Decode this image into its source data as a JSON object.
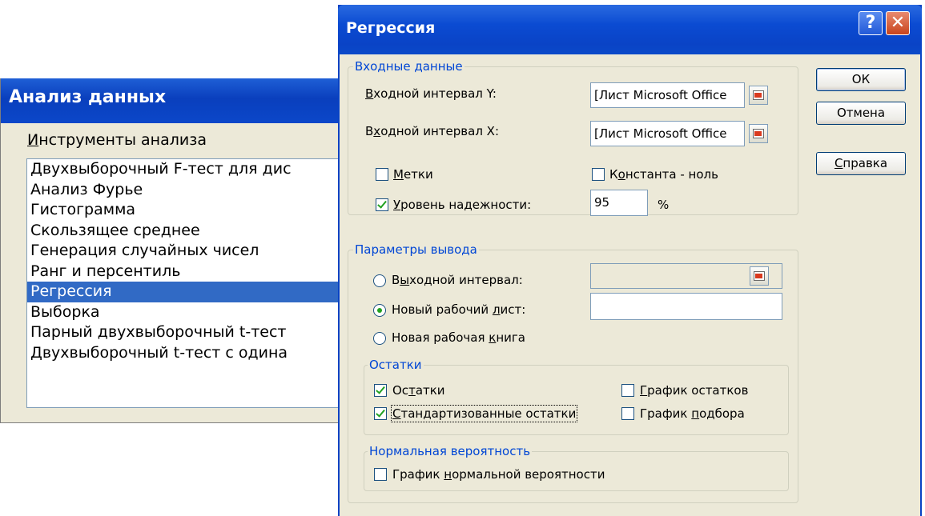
{
  "back_dialog": {
    "title": "Анализ данных",
    "tools_label": "Инструменты анализа",
    "tools": [
      "Двухвыборочный F-тест для дис",
      "Анализ Фурье",
      "Гистограмма",
      "Скользящее среднее",
      "Генерация случайных чисел",
      "Ранг и персентиль",
      "Регрессия",
      "Выборка",
      "Парный двухвыборочный t-тест",
      "Двухвыборочный t-тест с одина"
    ],
    "selected_tool": "Регрессия"
  },
  "dialog": {
    "title": "Регрессия",
    "help_glyph": "?",
    "close_glyph": "✕",
    "input": {
      "legend": "Входные данные",
      "y_label": "Входной интервал Y:",
      "y_value": "[Лист Microsoft Office",
      "x_label": "Входной интервал X:",
      "x_value": "[Лист Microsoft Office",
      "labels_label": "Метки",
      "labels_checked": false,
      "constant_zero_label": "Константа - ноль",
      "constant_zero_checked": false,
      "confidence_label": "Уровень надежности:",
      "confidence_checked": true,
      "confidence_value": "95",
      "percent_sign": "%"
    },
    "output": {
      "legend": "Параметры вывода",
      "output_range_label": "Выходной интервал:",
      "new_sheet_label": "Новый рабочий лист:",
      "new_workbook_label": "Новая рабочая книга",
      "selected_option": "new_sheet",
      "output_range_value": "",
      "new_sheet_value": ""
    },
    "residuals": {
      "legend": "Остатки",
      "residuals_label": "Остатки",
      "residuals_checked": true,
      "standardized_label": "Стандартизованные остатки",
      "standardized_checked": true,
      "residual_plot_label": "График остатков",
      "residual_plot_checked": false,
      "fit_plot_label": "График подбора",
      "fit_plot_checked": false
    },
    "normal": {
      "legend": "Нормальная вероятность",
      "normal_plot_label": "График нормальной вероятности",
      "normal_plot_checked": false
    },
    "buttons": {
      "ok": "ОК",
      "cancel": "Отмена",
      "help": "Справка"
    }
  }
}
